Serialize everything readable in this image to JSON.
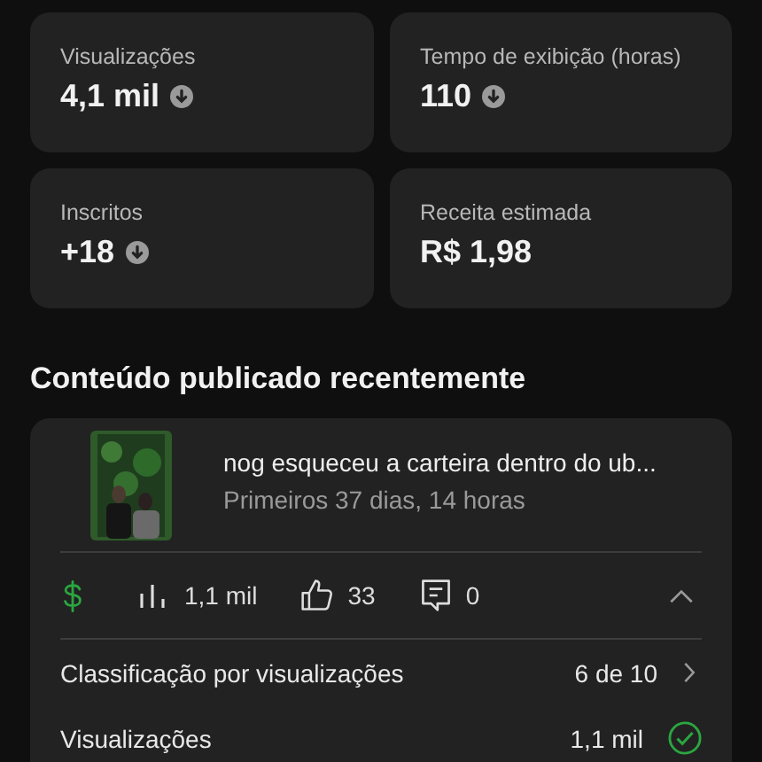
{
  "stats": [
    {
      "label": "Visualizações",
      "value": "4,1 mil",
      "decreased": true
    },
    {
      "label": "Tempo de exibição (horas)",
      "value": "110",
      "decreased": true
    },
    {
      "label": "Inscritos",
      "value": "+18",
      "decreased": true
    },
    {
      "label": "Receita estimada",
      "value": "R$ 1,98",
      "decreased": false
    }
  ],
  "section_title": "Conteúdo publicado recentemente",
  "video": {
    "title": "nog esqueceu a carteira dentro do ub...",
    "subtitle": "Primeiros 37 dias, 14 horas",
    "metrics": [
      {
        "kind": "views",
        "value": "1,1 mil"
      },
      {
        "kind": "likes",
        "value": "33"
      },
      {
        "kind": "comments",
        "value": "0"
      }
    ],
    "expanded": true,
    "rows": [
      {
        "kind": "link",
        "label": "Classificação por visualizações",
        "value": "6 de 10"
      },
      {
        "kind": "check",
        "label": "Visualizações",
        "value": "1,1 mil"
      }
    ]
  }
}
